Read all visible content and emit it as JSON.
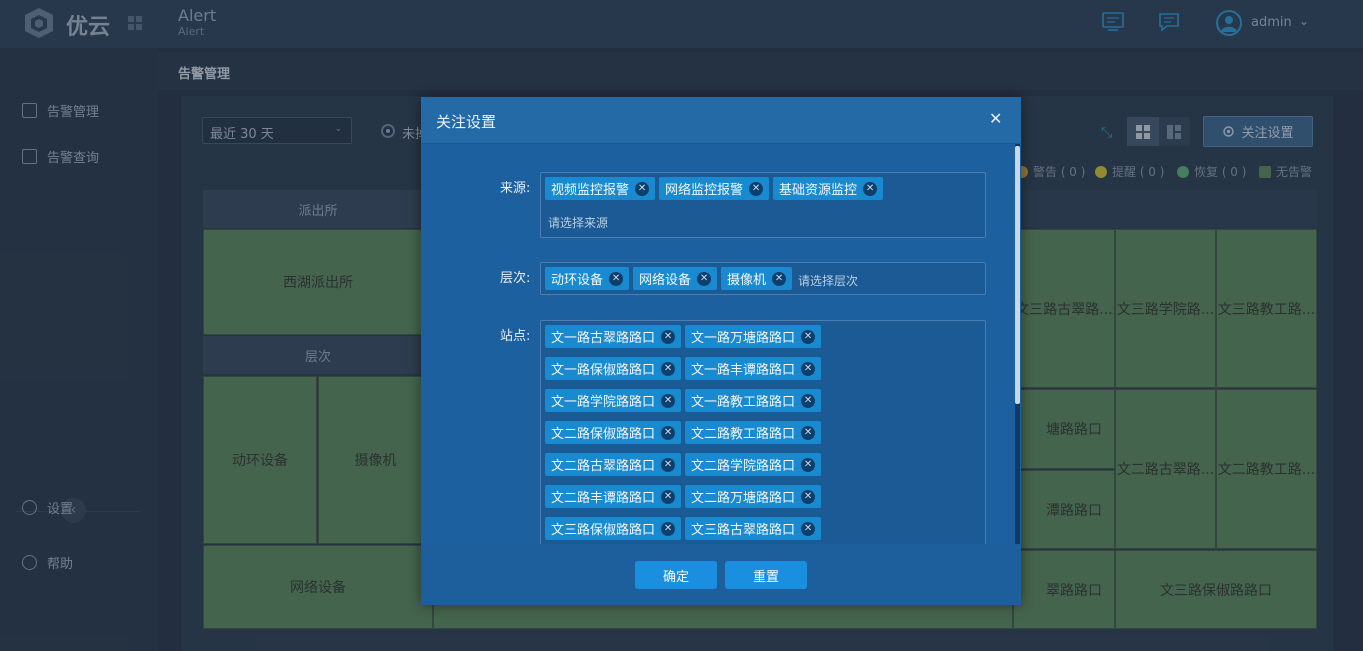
{
  "app": {
    "brand": "优云",
    "page_title": "Alert",
    "page_subtitle": "Alert"
  },
  "user": {
    "name": "admin"
  },
  "sidebar": {
    "items": [
      {
        "label": "告警管理"
      },
      {
        "label": "告警查询"
      },
      {
        "label": "设置"
      },
      {
        "label": "帮助"
      }
    ]
  },
  "content": {
    "title": "告警管理"
  },
  "toolbar": {
    "range_select": "最近 30 天",
    "radio_label": "未掉",
    "follow_button": "关注设置"
  },
  "legend": [
    {
      "label": "警告 ( 0 )",
      "color": "#d6a13a"
    },
    {
      "label": "提醒 ( 0 )",
      "color": "#d6c73a"
    },
    {
      "label": "恢复 ( 0 )",
      "color": "#5fb37c"
    },
    {
      "label": "无告警",
      "color": "#5f8b62"
    }
  ],
  "grid": {
    "headers": {
      "station_group": "派出所",
      "level": "层次"
    },
    "cells": {
      "xihu": "西湖派出所",
      "dhsb": "动环设备",
      "sxj": "摄像机",
      "wlsb": "网络设备",
      "c1": "文三路古翠路...",
      "c2": "文三路学院路...",
      "c3": "文三路教工路...",
      "c4": "塘路路口",
      "c5": "文二路古翠路...",
      "c6": "文二路教工路...",
      "c7": "潭路路口",
      "c8": "翠路路口",
      "c9": "文三路保俶路路口"
    }
  },
  "modal": {
    "title": "关注设置",
    "source_label": "来源:",
    "level_label": "层次:",
    "site_label": "站点:",
    "source_tags": [
      "视频监控报警",
      "网络监控报警",
      "基础资源监控"
    ],
    "source_placeholder": "请选择来源",
    "level_tags": [
      "动环设备",
      "网络设备",
      "摄像机"
    ],
    "level_placeholder": "请选择层次",
    "site_tags": [
      "文一路古翠路路口",
      "文一路万塘路路口",
      "文一路保俶路路口",
      "文一路丰谭路路口",
      "文一路学院路路口",
      "文一路教工路路口",
      "文二路保俶路路口",
      "文二路教工路路口",
      "文二路古翠路路口",
      "文二路学院路路口",
      "文二路丰谭路路口",
      "文二路万塘路路口",
      "文三路保俶路路口",
      "文三路古翠路路口"
    ],
    "confirm": "确定",
    "reset": "重置"
  }
}
